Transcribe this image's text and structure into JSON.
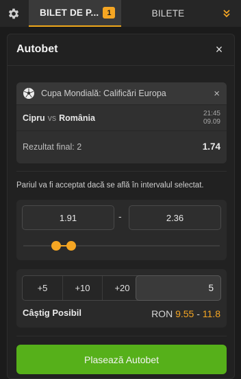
{
  "topbar": {
    "active_tab": "BILET DE P...",
    "badge": "1",
    "other_tab": "BILETE"
  },
  "icons": {
    "gear": "gear-icon",
    "chevron": "double-chevron-down-icon",
    "close": "close-icon",
    "ball": "soccer-ball-icon"
  },
  "modal": {
    "title": "Autobet",
    "close": "×"
  },
  "match": {
    "competition": "Cupa Mondială: Calificări Europa",
    "home": "Cipru",
    "vs": "vs",
    "away": "România",
    "time": "21:45",
    "date": "09.09",
    "market": "Rezultat final: 2",
    "odd": "1.74",
    "close": "×"
  },
  "range": {
    "note": "Pariul va fi acceptat dacă se află în intervalul selectat.",
    "min": "1.91",
    "separator": "-",
    "max": "2.36"
  },
  "stake": {
    "quick": [
      "+5",
      "+10",
      "+20"
    ],
    "value": "5",
    "win_label": "Câștig Posibil",
    "currency": "RON",
    "win_min": "9.55",
    "win_sep": "-",
    "win_max": "11.8"
  },
  "actions": {
    "place": "Plasează Autobet"
  },
  "colors": {
    "accent": "#f5a623",
    "button": "#56b01a",
    "background": "#1b1b1b"
  }
}
